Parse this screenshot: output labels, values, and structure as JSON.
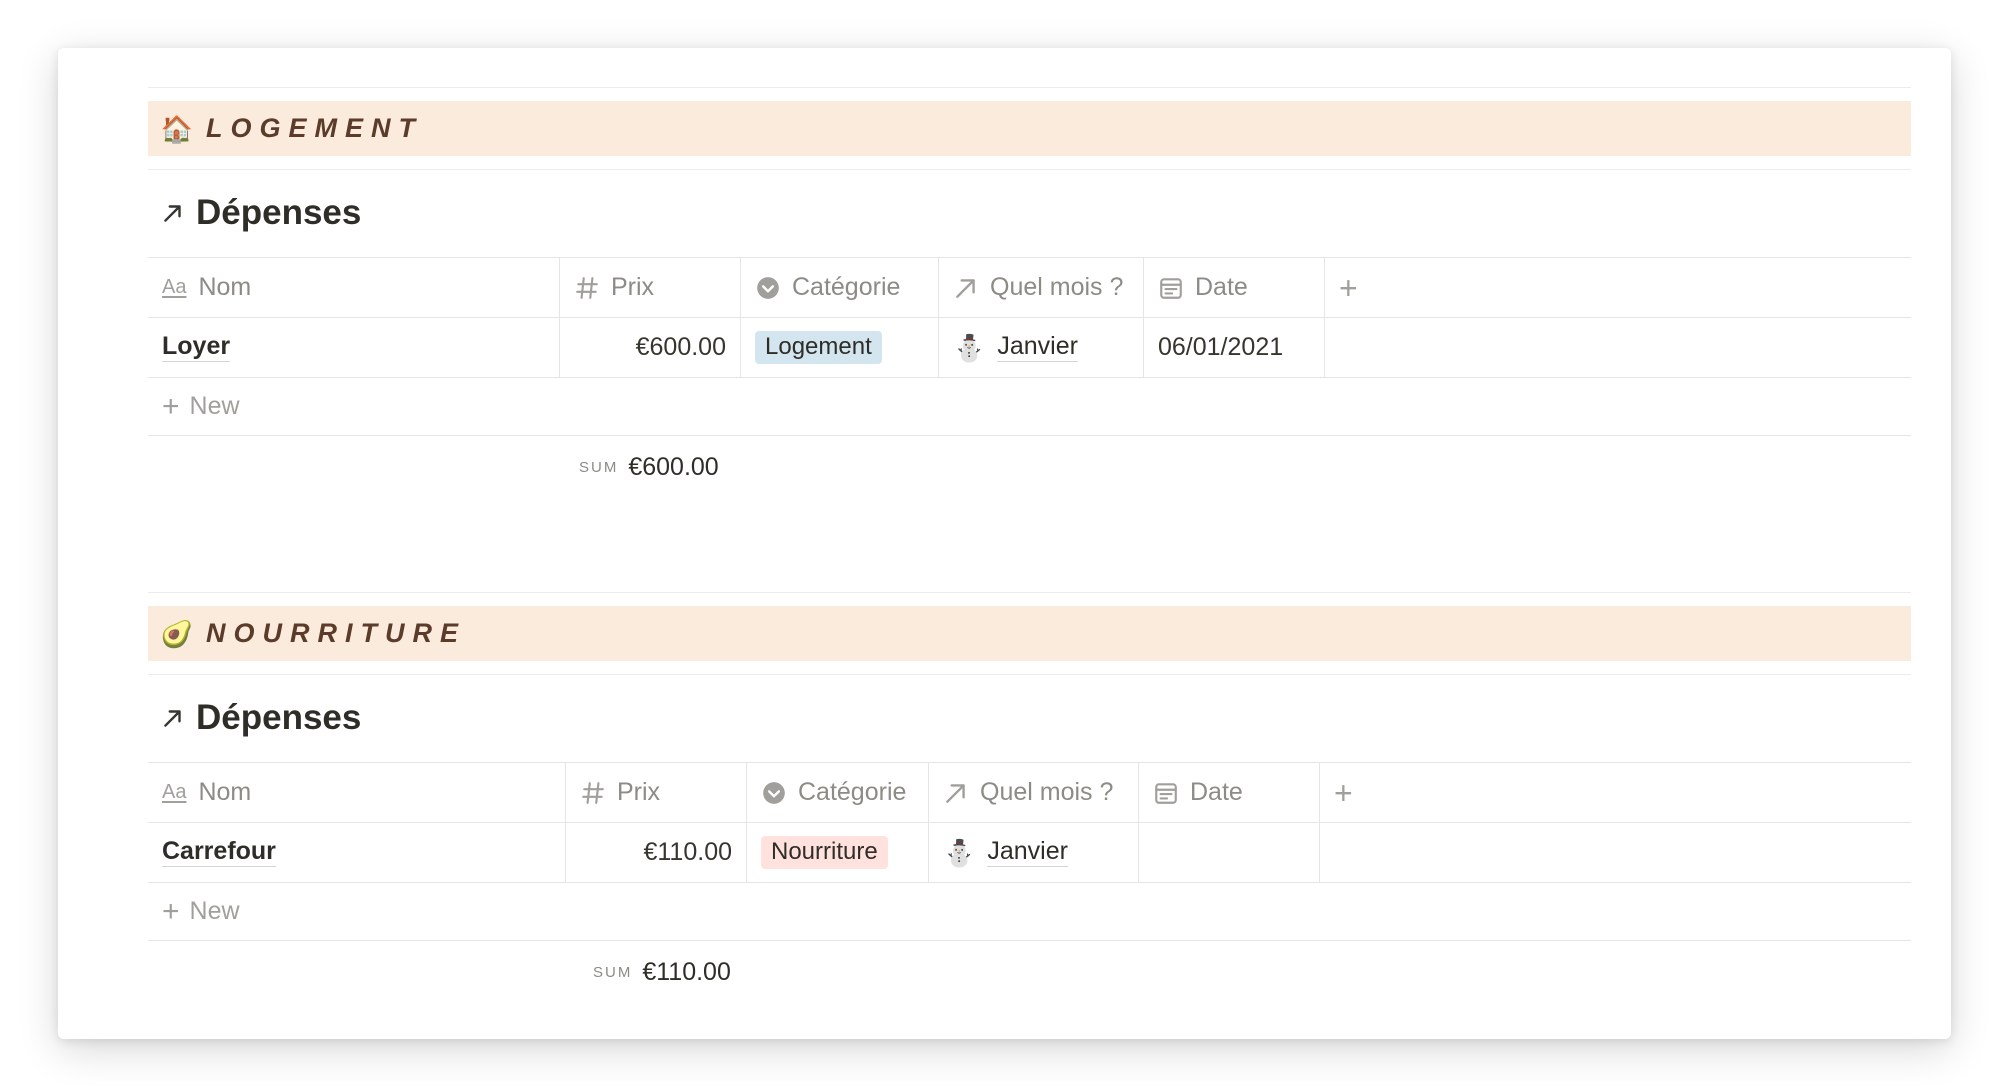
{
  "sections": [
    {
      "emoji": "🏠",
      "title": "LOGEMENT",
      "database_title": "Dépenses",
      "columns": {
        "name": "Nom",
        "name_icon_text": "Aa",
        "price": "Prix",
        "category": "Catégorie",
        "month": "Quel mois ?",
        "date": "Date",
        "add": "+"
      },
      "rows": [
        {
          "name": "Loyer",
          "price": "€600.00",
          "category": "Logement",
          "category_color": "#d3e5ef",
          "month_emoji": "⛄",
          "month": "Janvier",
          "date": "06/01/2021"
        }
      ],
      "new_label": "New",
      "sum_label": "SUM",
      "sum_value": "€600.00"
    },
    {
      "emoji": "🥑",
      "title": "NOURRITURE",
      "database_title": "Dépenses",
      "columns": {
        "name": "Nom",
        "name_icon_text": "Aa",
        "price": "Prix",
        "category": "Catégorie",
        "month": "Quel mois ?",
        "date": "Date",
        "add": "+"
      },
      "rows": [
        {
          "name": "Carrefour",
          "price": "€110.00",
          "category": "Nourriture",
          "category_color": "#ffe2dd",
          "month_emoji": "⛄",
          "month": "Janvier",
          "date": ""
        }
      ],
      "new_label": "New",
      "sum_label": "SUM",
      "sum_value": "€110.00"
    }
  ],
  "colors": {
    "banner_bg": "#fbebdd",
    "banner_text": "#5b3b2a"
  },
  "icons": {
    "name_column": "text-aa-icon",
    "price_column": "hash-icon",
    "category_column": "select-chevron-icon",
    "month_column": "relation-arrow-icon",
    "date_column": "calendar-icon",
    "database_link": "arrow-up-right-icon",
    "new_row": "plus-icon"
  }
}
